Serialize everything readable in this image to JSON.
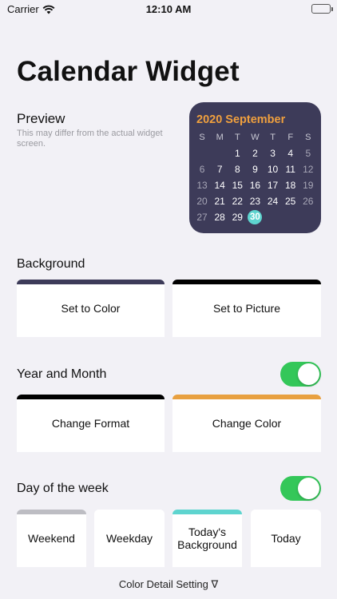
{
  "status_bar": {
    "carrier": "Carrier",
    "time": "12:10 AM"
  },
  "page_title": "Calendar Widget",
  "preview": {
    "title": "Preview",
    "description": "This may differ from the actual widget screen."
  },
  "widget": {
    "title": "2020 September",
    "weekday_headers": [
      "S",
      "M",
      "T",
      "W",
      "T",
      "F",
      "S"
    ],
    "weeks": [
      [
        "",
        "",
        "1",
        "2",
        "3",
        "4",
        "5"
      ],
      [
        "6",
        "7",
        "8",
        "9",
        "10",
        "11",
        "12"
      ],
      [
        "13",
        "14",
        "15",
        "16",
        "17",
        "18",
        "19"
      ],
      [
        "20",
        "21",
        "22",
        "23",
        "24",
        "25",
        "26"
      ],
      [
        "27",
        "28",
        "29",
        "30",
        "",
        "",
        ""
      ]
    ],
    "today": "30",
    "colors": {
      "background": "#3d3b59",
      "title": "#f0a03e",
      "today": "#5ed4cf"
    }
  },
  "background_section": {
    "label": "Background",
    "buttons": [
      {
        "label": "Set to Color",
        "color": "#3d3b59"
      },
      {
        "label": "Set to Picture",
        "color": "#000000"
      }
    ]
  },
  "year_month_section": {
    "label": "Year and Month",
    "toggle_on": true,
    "buttons": [
      {
        "label": "Change Format",
        "color": "#000000"
      },
      {
        "label": "Change Color",
        "color": "#e8a040"
      }
    ]
  },
  "day_of_week_section": {
    "label": "Day of the week",
    "toggle_on": true,
    "buttons": [
      {
        "label": "Weekend",
        "color": "#bdbdc3"
      },
      {
        "label": "Weekday",
        "color": "#ffffff"
      },
      {
        "label": "Today's Background",
        "color": "#5ed4cf"
      },
      {
        "label": "Today",
        "color": "#ffffff"
      }
    ]
  },
  "footer": {
    "label": "Color Detail Setting ∇"
  },
  "colors": {
    "page_background": "#f2f1f6",
    "toggle_on": "#34c759"
  },
  "icons": {
    "wifi": "wifi-icon",
    "battery": "battery-icon"
  }
}
